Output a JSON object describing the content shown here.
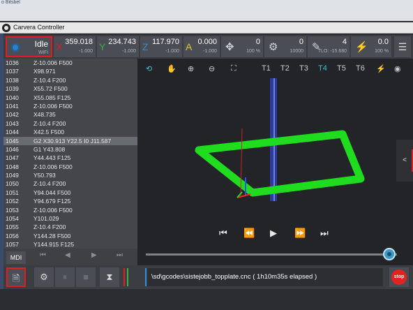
{
  "window": {
    "title": "Carvera Controller",
    "behind_fragment": "o Bitsbel"
  },
  "status": {
    "state": "Idle",
    "connection": "WiFi",
    "x": {
      "label": "X",
      "value": "359.018",
      "sub": "-1.000",
      "color": "#e31b23"
    },
    "y": {
      "label": "Y",
      "value": "234.743",
      "sub": "-1.000",
      "color": "#36b24a"
    },
    "z": {
      "label": "Z",
      "value": "117.970",
      "sub": "-1.000",
      "color": "#2f8ed8"
    },
    "a": {
      "label": "A",
      "value": "0.000",
      "sub": "-1.000",
      "color": "#e3c532"
    },
    "feed": {
      "value": "0",
      "sub": "100 %"
    },
    "spindle": {
      "value": "0",
      "sub": "10000"
    },
    "tool": {
      "value": "4",
      "sub": "TLO: -15.680"
    },
    "laser": {
      "value": "0.0",
      "sub": "100 %"
    }
  },
  "gcode": [
    {
      "ln": "1036",
      "code": "Z-10.006 F500"
    },
    {
      "ln": "1037",
      "code": "X98.971"
    },
    {
      "ln": "1038",
      "code": "Z-10.4 F200"
    },
    {
      "ln": "1039",
      "code": "X55.72 F500"
    },
    {
      "ln": "1040",
      "code": "X55.085 F125"
    },
    {
      "ln": "1041",
      "code": "Z-10.006 F500"
    },
    {
      "ln": "1042",
      "code": "X48.735"
    },
    {
      "ln": "1043",
      "code": "Z-10.4 F200"
    },
    {
      "ln": "1044",
      "code": "X42.5 F500"
    },
    {
      "ln": "1045",
      "code": "G2 X30.913 Y22.5 I0 J11.587",
      "active": true
    },
    {
      "ln": "1046",
      "code": "G1 Y43.808"
    },
    {
      "ln": "1047",
      "code": "Y44.443 F125"
    },
    {
      "ln": "1048",
      "code": "Z-10.006 F500"
    },
    {
      "ln": "1049",
      "code": "Y50.793"
    },
    {
      "ln": "1050",
      "code": "Z-10.4 F200"
    },
    {
      "ln": "1051",
      "code": "Y94.044 F500"
    },
    {
      "ln": "1052",
      "code": "Y94.679 F125"
    },
    {
      "ln": "1053",
      "code": "Z-10.006 F500"
    },
    {
      "ln": "1054",
      "code": "Y101.029"
    },
    {
      "ln": "1055",
      "code": "Z-10.4 F200"
    },
    {
      "ln": "1056",
      "code": "Y144.28 F500"
    },
    {
      "ln": "1057",
      "code": "Y144.915 F125"
    }
  ],
  "mdi_label": "MDI",
  "viewer": {
    "tools": [
      "T1",
      "T2",
      "T3",
      "T4",
      "T5",
      "T6"
    ],
    "active_tool": "T4",
    "side_handle": "<"
  },
  "job": {
    "file_status": "\\sd\\gcodes\\sistejobb_topplate.cnc ( 1h10m35s elapsed )",
    "progress": 0.97,
    "stop_label": "stop"
  }
}
